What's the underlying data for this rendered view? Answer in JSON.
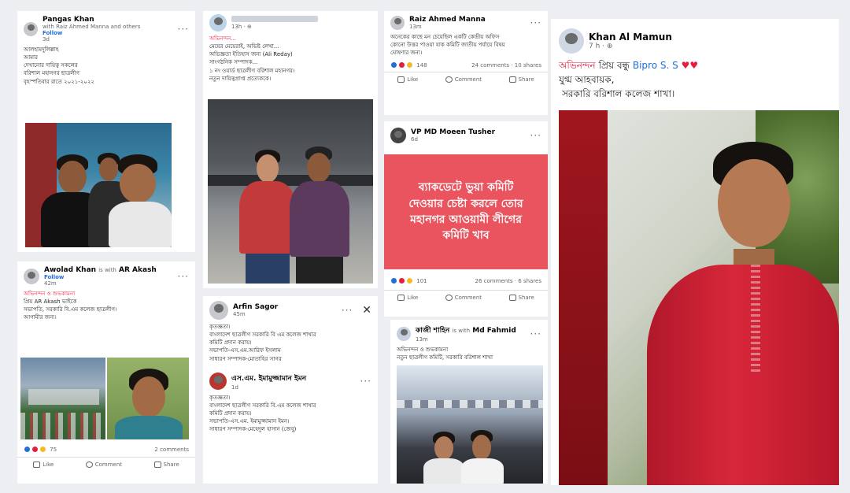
{
  "col1": {
    "post1": {
      "author": "Pangas Khan",
      "meta_line": "with Raiz Ahmed Manna and others",
      "follow": "Follow",
      "time": "3d",
      "lines": [
        "আলহামদুলিল্লাহ",
        "আমার",
        "দেখানোর দায়িত্ব সকলের",
        "বরিশাল মহানগর ছাত্রলীগ",
        "বৃহস্পতিবার রাতে ২০২১-২০২২"
      ]
    },
    "post2": {
      "author": "Awolad Khan",
      "with": "is with",
      "tagged": "AR Akash",
      "follow": "Follow",
      "time": "42m",
      "lines": [
        "অভিনন্দন ও শুভকামনা",
        "প্রিয় AR Akash ভাইকে",
        "সভাপতি, সরকারি বি.এম কলেজ ছাত্রলীগ।",
        "আগামীর জন্য।"
      ],
      "reactions": "75",
      "comments": "2 comments",
      "like": "Like",
      "comment": "Comment",
      "share": "Share"
    }
  },
  "col2": {
    "post1": {
      "lines": [
        "অভিনন্দন...",
        "মেয়ের মেয়েরাই, অভিষ্ট লেখা...",
        "অভিজ্ঞতা ইতিহাস জন্য (Ali Reday)",
        "সাংগঠনিক সম্পাদক...",
        "১ নং ওয়ার্ড ছাত্রলীগ বরিশাল মহানগর।",
        "নতুন দায়িত্বপ্রাপ্ত প্রত্যেককে।"
      ]
    },
    "post2": {
      "author": "Arfin Sagor",
      "time": "45m",
      "lines": [
        "কৃতজ্ঞতা।",
        "বাংলাদেশ ছাত্রলীগ সরকারি বি এম কলেজ শাখার",
        "কমিটি প্রদান করায়।",
        "সভাপতি-এস.এম.আরিফ ইসলাম",
        "সাধারণ সম্পাদক-মোতাহির সাগর"
      ]
    },
    "post3": {
      "author": "এস.এম. ইমামুজ্জামান ইমন",
      "time": "1d",
      "lines": [
        "কৃতজ্ঞতা।",
        "বাংলাদেশ ছাত্রলীগ সরকারি বি.এম কলেজ শাখার",
        "কমিটি প্রদান করায়।",
        "সভাপতি-এস.এম. ইমামুজ্জামান ইমন।",
        "সাধারণ সম্পাদক-মেহেদুল হাসান (জেবু)"
      ]
    }
  },
  "col3": {
    "post1": {
      "author": "Raiz Ahmed Manna",
      "time": "13m",
      "lines": [
        "অনেকের কাছে মন চেয়েছিল একটি কেন্দ্রীয় অফিস",
        "কোনো উত্তর পাওয়া যাক কমিটি জাতীয় পর্যায়ে বিষয়",
        "ঘোষণার জন্য।"
      ],
      "reactions": "148",
      "comments": "24 comments · 10 shares",
      "like": "Like",
      "comment": "Comment",
      "share": "Share"
    },
    "post2": {
      "author": "VP MD Moeen Tusher",
      "time": "6d",
      "banner": [
        "ব্যাকডেটে ভুয়া কমিটি",
        "দেওয়ার চেষ্টা করলে তোর",
        "মহানগর আওয়ামী লীগের",
        "কমিটি খাব"
      ],
      "reactions": "101",
      "comments": "26 comments · 6 shares",
      "like": "Like",
      "comment": "Comment",
      "share": "Share"
    },
    "post3": {
      "author": "কাজী শাহিন",
      "with": "is with",
      "tagged": "Md Fahmid",
      "time": "13m",
      "lines": [
        "অভিনন্দন ও শুভকামনা",
        "নতুন ছাত্রলীগ কমিটি, সরকারি বরিশাল শাখা"
      ]
    }
  },
  "col4": {
    "author": "Khan Al Mamun",
    "time": "7 h ·",
    "greet": "অভিনন্দন",
    "friend_prefix": "প্রিয় বন্ধু",
    "friend": "Bipro S. S",
    "line2": "যুগ্ম আহবায়ক,",
    "line3": "সরকারি বরিশাল কলেজ শাখা।"
  },
  "colors": {
    "fb_blue": "#216fdb",
    "red": "#e41e3f",
    "banner": "#e9545f"
  }
}
